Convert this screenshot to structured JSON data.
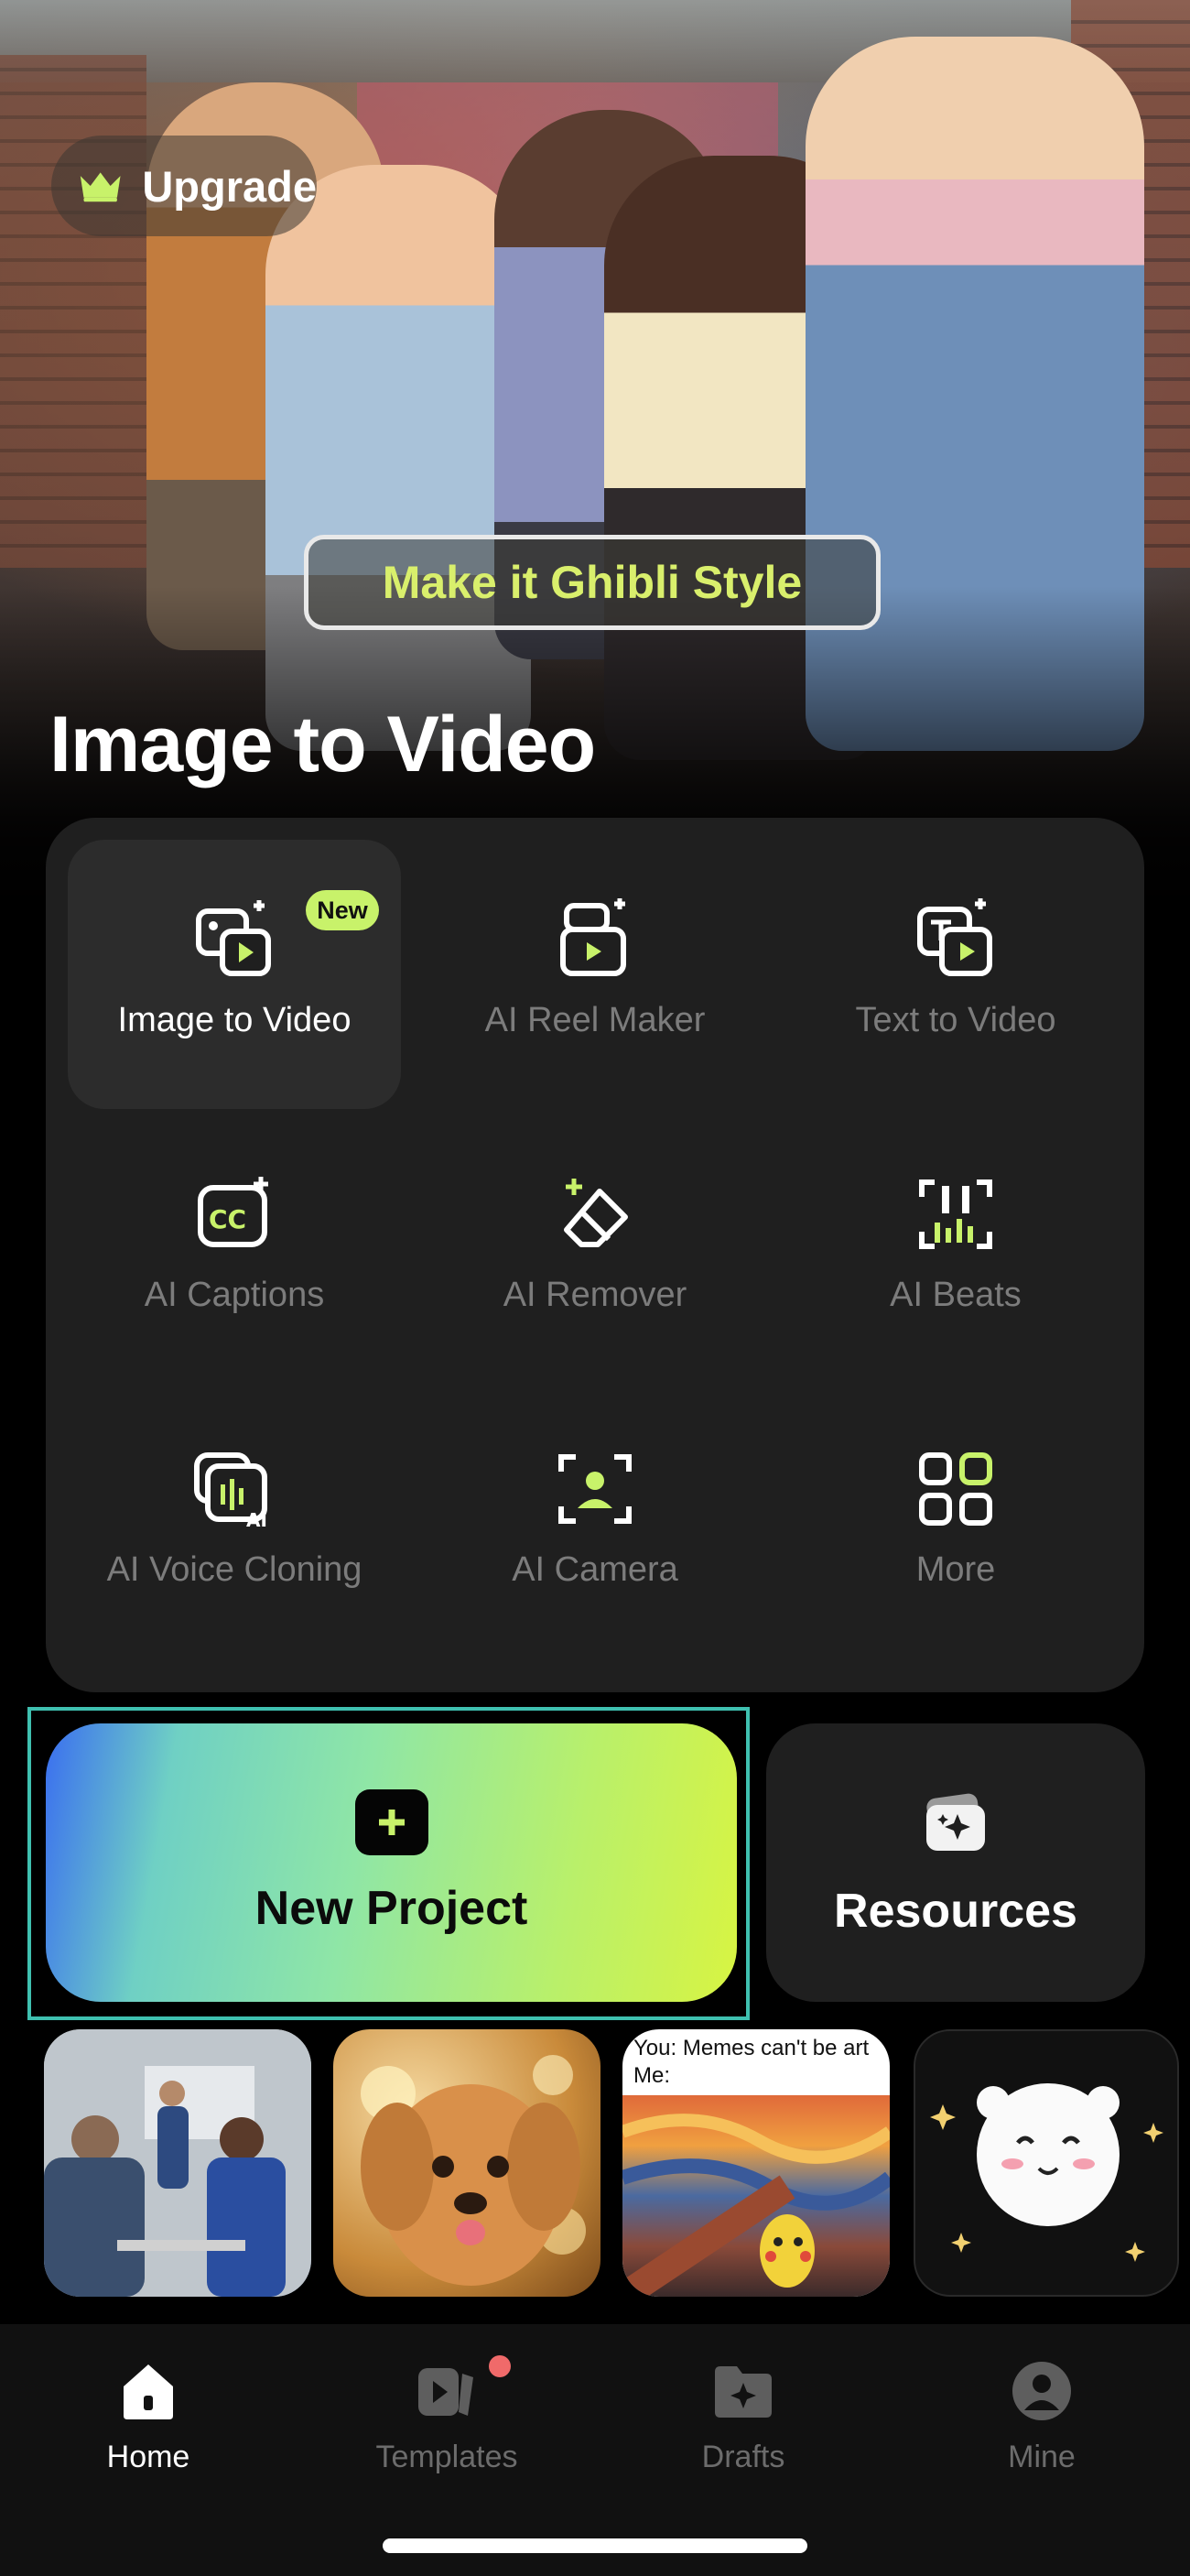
{
  "hero": {
    "upgrade_label": "Upgrade",
    "banner_label": "Make it Ghibli Style",
    "title": "Image to Video"
  },
  "tools": [
    {
      "label": "Image to Video",
      "icon": "image-to-video-icon",
      "badge": "New",
      "active": true
    },
    {
      "label": "AI Reel Maker",
      "icon": "reel-maker-icon"
    },
    {
      "label": "Text to Video",
      "icon": "text-to-video-icon"
    },
    {
      "label": "AI Captions",
      "icon": "captions-icon"
    },
    {
      "label": "AI Remover",
      "icon": "eraser-icon"
    },
    {
      "label": "AI Beats",
      "icon": "beats-icon"
    },
    {
      "label": "AI Voice Cloning",
      "icon": "voice-cloning-icon"
    },
    {
      "label": "AI Camera",
      "icon": "camera-icon"
    },
    {
      "label": "More",
      "icon": "grid-icon"
    }
  ],
  "actions": {
    "new_project_label": "New Project",
    "resources_label": "Resources"
  },
  "thumbnails": {
    "meme_text": "You: Memes can't be art\nMe:"
  },
  "tabs": [
    {
      "label": "Home",
      "icon": "home-icon",
      "active": true
    },
    {
      "label": "Templates",
      "icon": "templates-icon",
      "notification": true
    },
    {
      "label": "Drafts",
      "icon": "drafts-icon"
    },
    {
      "label": "Mine",
      "icon": "profile-icon"
    }
  ],
  "colors": {
    "accent": "#c8f26a",
    "panel": "#1f1f1f",
    "focus_ring": "#3fc0b0",
    "notification_dot": "#f06a6a"
  }
}
